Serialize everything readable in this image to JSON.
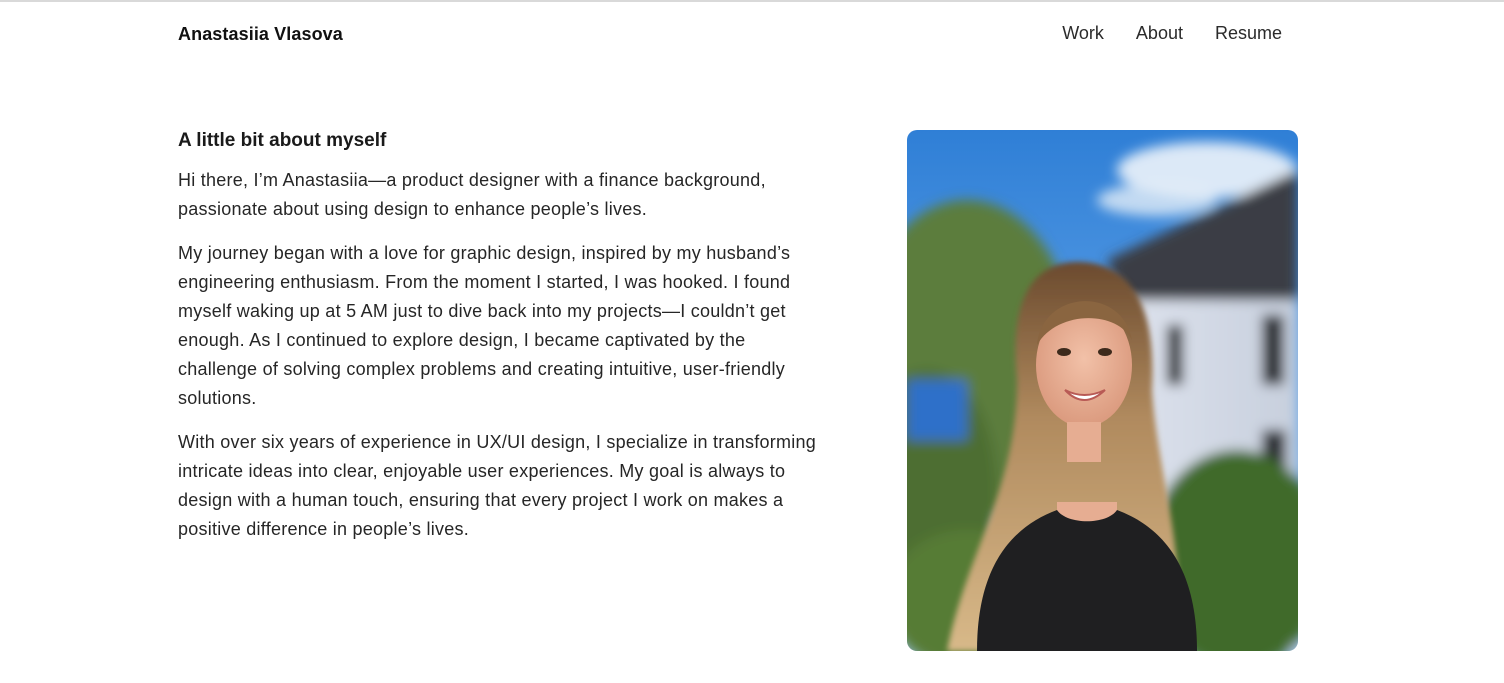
{
  "header": {
    "brand": "Anastasiia Vlasova",
    "nav": {
      "work": "Work",
      "about": "About",
      "resume": "Resume"
    }
  },
  "about": {
    "heading": "A little bit about myself",
    "paragraphs": [
      "Hi there, I’m Anastasiia—a product designer with a finance background, passionate about using design to enhance people’s lives.",
      "My journey began with a love for graphic design, inspired by my husband’s engineering enthusiasm. From the moment I started, I was hooked. I found myself waking up at 5 AM just to dive back into my projects—I couldn’t get enough. As I continued to explore design, I became captivated by the challenge of solving complex problems and creating intuitive, user-friendly solutions.",
      "With over six years of experience in UX/UI design, I specialize in transforming intricate ideas into clear, enjoyable user experiences. My goal is always to design with a human touch, ensuring that every project I work on makes a positive difference in people’s lives."
    ]
  },
  "photo": {
    "icon": "portrait-photo"
  }
}
